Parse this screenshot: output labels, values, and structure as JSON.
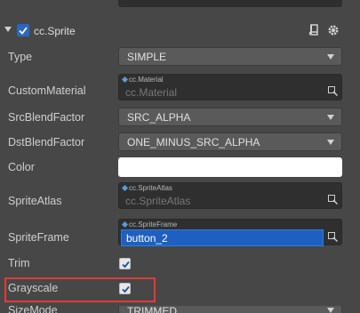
{
  "component": {
    "title": "cc.Sprite",
    "enabled": true
  },
  "properties": {
    "type": {
      "label": "Type",
      "value": "SIMPLE"
    },
    "custom_material": {
      "label": "CustomMaterial",
      "tag": "cc.Material",
      "value": "cc.Material"
    },
    "src_blend": {
      "label": "SrcBlendFactor",
      "value": "SRC_ALPHA"
    },
    "dst_blend": {
      "label": "DstBlendFactor",
      "value": "ONE_MINUS_SRC_ALPHA"
    },
    "color": {
      "label": "Color",
      "value": "#ffffff"
    },
    "sprite_atlas": {
      "label": "SpriteAtlas",
      "tag": "cc.SpriteAtlas",
      "value": "cc.SpriteAtlas"
    },
    "sprite_frame": {
      "label": "SpriteFrame",
      "tag": "cc.SpriteFrame",
      "value": "button_2"
    },
    "trim": {
      "label": "Trim",
      "checked": true
    },
    "grayscale": {
      "label": "Grayscale",
      "checked": true
    },
    "size_mode": {
      "label": "SizeMode",
      "value": "TRIMMED"
    }
  },
  "colors": {
    "accent": "#2b66c2",
    "highlight": "#e53935",
    "selected_field": "#1e5fc0"
  }
}
